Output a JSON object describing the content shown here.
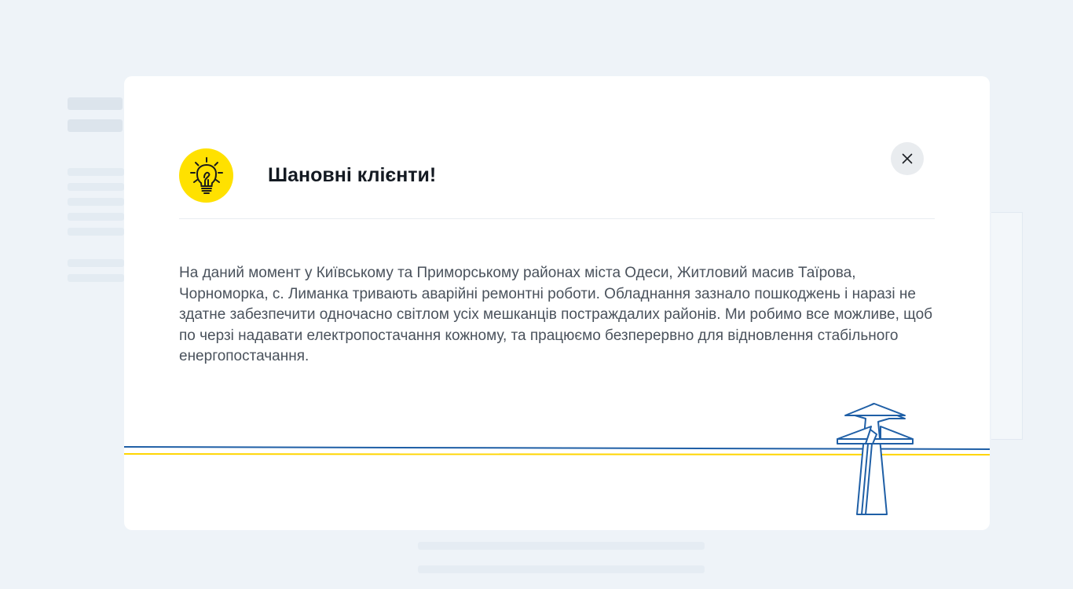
{
  "notice": {
    "icon": "lightbulb-icon",
    "title": "Шановні клієнти!",
    "message": "На даний момент у Київському та Приморському районах міста Одеси, Житловий масив Таїрова, Чорноморка, с. Лиманка тривають аварійні ремонтні роботи. Обладнання зазнало пошкоджень і наразі не здатне забезпечити одночасно світлом усіх мешканців постраждалих районів. Ми робимо все можливе, щоб по черзі надавати електропостачання кожному, та працюємо безперервно для відновлення стабільного енергопостачання.",
    "close_icon": "close-icon",
    "illustration_icon": "power-tower-icon"
  },
  "colors": {
    "accent_yellow": "#ffe100",
    "line_blue": "#1f5fa6",
    "line_yellow": "#ffd500",
    "overlay": "#eef3f8"
  }
}
